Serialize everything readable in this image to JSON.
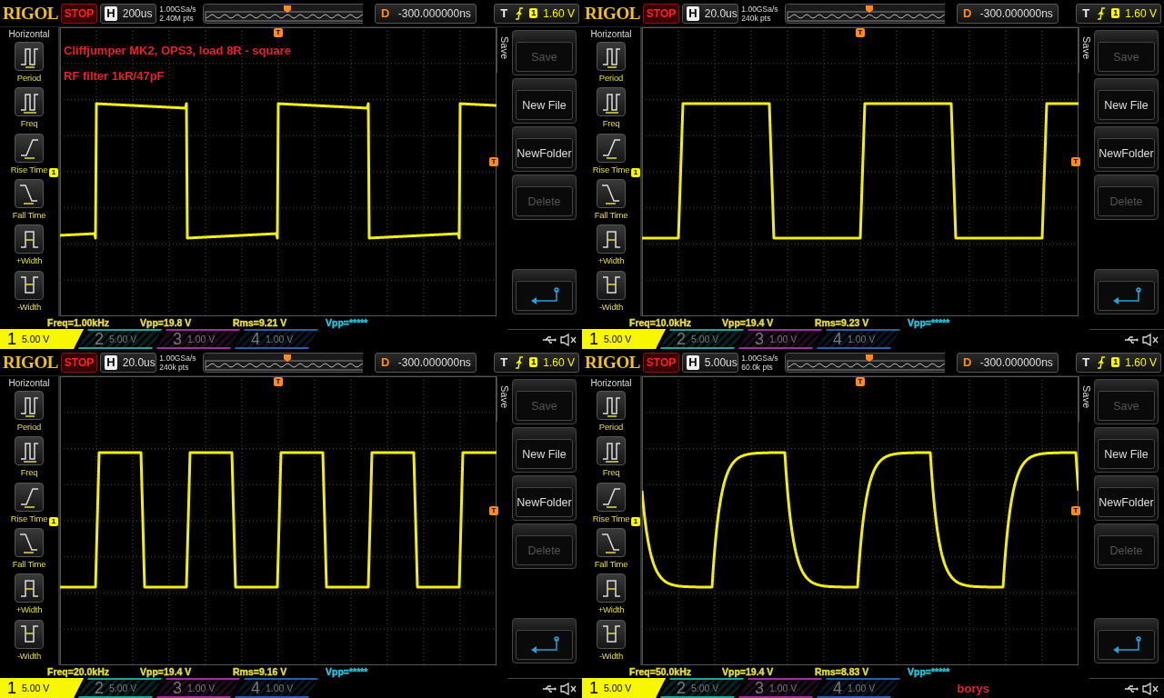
{
  "panels": [
    {
      "brand": "RIGOL",
      "run_state": "STOP",
      "timebase_label": "H",
      "timebase": "200us",
      "sample_rate": "1.00GSa/s",
      "memory_depth": "2.40M pts",
      "delay_label": "D",
      "delay": "-300.000000ns",
      "trigger_label": "T",
      "trigger_source": "1",
      "trigger_level": "1.60 V",
      "sidebar_title": "Horizontal",
      "sidebar_items": [
        {
          "label": "Period",
          "kind": "period"
        },
        {
          "label": "Freq",
          "kind": "freq"
        },
        {
          "label": "Rise Time",
          "kind": "rise"
        },
        {
          "label": "Fall Time",
          "kind": "fall"
        },
        {
          "label": "+Width",
          "kind": "pwidth"
        },
        {
          "label": "-Width",
          "kind": "nwidth"
        }
      ],
      "notes": [
        "Cliffjumper MK2, OPS3, load 8R - square",
        "RF filter 1kR/47pF"
      ],
      "channel_marker": "1",
      "trigger_marker_top": "T",
      "trigger_marker_right": "T",
      "menu_title": "Save",
      "menu_buttons": [
        {
          "kind": "text",
          "label": "Save",
          "disabled": true
        },
        {
          "kind": "text",
          "label": "New File",
          "disabled": false
        },
        {
          "kind": "text",
          "label": "NewFolder",
          "disabled": false
        },
        {
          "kind": "text",
          "label": "Delete",
          "disabled": true
        },
        {
          "kind": "enter"
        }
      ],
      "measurements": [
        {
          "text": "Freq=1.00kHz",
          "kind": "ch1"
        },
        {
          "text": "Vpp=19.8 V",
          "kind": "ch1"
        },
        {
          "text": "Rms=9.21 V",
          "kind": "ch1"
        },
        {
          "text": "Vpp=*****",
          "kind": "ch2"
        }
      ],
      "channels": [
        {
          "number": "1",
          "scale": "5.00 V",
          "selected": true,
          "color": "#f7f700"
        },
        {
          "number": "2",
          "scale": "5.00 V",
          "selected": false,
          "color": "#1fa39a"
        },
        {
          "number": "3",
          "scale": "1.00 V",
          "selected": false,
          "color": "#a0309a"
        },
        {
          "number": "4",
          "scale": "1.00 V",
          "selected": false,
          "color": "#2a5fa8"
        }
      ]
    },
    {
      "brand": "RIGOL",
      "run_state": "STOP",
      "timebase_label": "H",
      "timebase": "20.0us",
      "sample_rate": "1.00GSa/s",
      "memory_depth": "240k pts",
      "delay_label": "D",
      "delay": "-300.000000ns",
      "trigger_label": "T",
      "trigger_source": "1",
      "trigger_level": "1.60 V",
      "sidebar_title": "Horizontal",
      "sidebar_items": [
        {
          "label": "Period",
          "kind": "period"
        },
        {
          "label": "Freq",
          "kind": "freq"
        },
        {
          "label": "Rise Time",
          "kind": "rise"
        },
        {
          "label": "Fall Time",
          "kind": "fall"
        },
        {
          "label": "+Width",
          "kind": "pwidth"
        },
        {
          "label": "-Width",
          "kind": "nwidth"
        }
      ],
      "channel_marker": "1",
      "trigger_marker_top": "T",
      "trigger_marker_right": "T",
      "menu_title": "Save",
      "menu_buttons": [
        {
          "kind": "text",
          "label": "Save",
          "disabled": true
        },
        {
          "kind": "text",
          "label": "New File",
          "disabled": false
        },
        {
          "kind": "text",
          "label": "NewFolder",
          "disabled": false
        },
        {
          "kind": "text",
          "label": "Delete",
          "disabled": true
        },
        {
          "kind": "enter"
        }
      ],
      "measurements": [
        {
          "text": "Freq=10.0kHz",
          "kind": "ch1"
        },
        {
          "text": "Vpp=19.4 V",
          "kind": "ch1"
        },
        {
          "text": "Rms=9.23 V",
          "kind": "ch1"
        },
        {
          "text": "Vpp=*****",
          "kind": "ch2"
        }
      ],
      "channels": [
        {
          "number": "1",
          "scale": "5.00 V",
          "selected": true,
          "color": "#f7f700"
        },
        {
          "number": "2",
          "scale": "5.00 V",
          "selected": false,
          "color": "#1fa39a"
        },
        {
          "number": "3",
          "scale": "1.00 V",
          "selected": false,
          "color": "#a0309a"
        },
        {
          "number": "4",
          "scale": "1.00 V",
          "selected": false,
          "color": "#2a5fa8"
        }
      ]
    },
    {
      "brand": "RIGOL",
      "run_state": "STOP",
      "timebase_label": "H",
      "timebase": "20.0us",
      "sample_rate": "1.00GSa/s",
      "memory_depth": "240k pts",
      "delay_label": "D",
      "delay": "-300.000000ns",
      "trigger_label": "T",
      "trigger_source": "1",
      "trigger_level": "1.60 V",
      "sidebar_title": "Horizontal",
      "sidebar_items": [
        {
          "label": "Period",
          "kind": "period"
        },
        {
          "label": "Freq",
          "kind": "freq"
        },
        {
          "label": "Rise Time",
          "kind": "rise"
        },
        {
          "label": "Fall Time",
          "kind": "fall"
        },
        {
          "label": "+Width",
          "kind": "pwidth"
        },
        {
          "label": "-Width",
          "kind": "nwidth"
        }
      ],
      "channel_marker": "1",
      "trigger_marker_top": "T",
      "trigger_marker_right": "T",
      "menu_title": "Save",
      "menu_buttons": [
        {
          "kind": "text",
          "label": "Save",
          "disabled": true
        },
        {
          "kind": "text",
          "label": "New File",
          "disabled": false
        },
        {
          "kind": "text",
          "label": "NewFolder",
          "disabled": false
        },
        {
          "kind": "text",
          "label": "Delete",
          "disabled": true
        },
        {
          "kind": "enter"
        }
      ],
      "measurements": [
        {
          "text": "Freq=20.0kHz",
          "kind": "ch1"
        },
        {
          "text": "Vpp=19.4 V",
          "kind": "ch1"
        },
        {
          "text": "Rms=9.16 V",
          "kind": "ch1"
        },
        {
          "text": "Vpp=*****",
          "kind": "ch2"
        }
      ],
      "channels": [
        {
          "number": "1",
          "scale": "5.00 V",
          "selected": true,
          "color": "#f7f700"
        },
        {
          "number": "2",
          "scale": "5.00 V",
          "selected": false,
          "color": "#1fa39a"
        },
        {
          "number": "3",
          "scale": "1.00 V",
          "selected": false,
          "color": "#a0309a"
        },
        {
          "number": "4",
          "scale": "1.00 V",
          "selected": false,
          "color": "#2a5fa8"
        }
      ]
    },
    {
      "brand": "RIGOL",
      "run_state": "STOP",
      "timebase_label": "H",
      "timebase": "5.00us",
      "sample_rate": "1.00GSa/s",
      "memory_depth": "60.0k pts",
      "delay_label": "D",
      "delay": "-300.000000ns",
      "trigger_label": "T",
      "trigger_source": "1",
      "trigger_level": "1.60 V",
      "sidebar_title": "Horizontal",
      "sidebar_items": [
        {
          "label": "Period",
          "kind": "period"
        },
        {
          "label": "Freq",
          "kind": "freq"
        },
        {
          "label": "Rise Time",
          "kind": "rise"
        },
        {
          "label": "Fall Time",
          "kind": "fall"
        },
        {
          "label": "+Width",
          "kind": "pwidth"
        },
        {
          "label": "-Width",
          "kind": "nwidth"
        }
      ],
      "channel_marker": "1",
      "trigger_marker_top": "T",
      "trigger_marker_right": "T",
      "menu_title": "Save",
      "menu_buttons": [
        {
          "kind": "text",
          "label": "Save",
          "disabled": true
        },
        {
          "kind": "text",
          "label": "New File",
          "disabled": false
        },
        {
          "kind": "text",
          "label": "NewFolder",
          "disabled": false
        },
        {
          "kind": "text",
          "label": "Delete",
          "disabled": true
        },
        {
          "kind": "enter"
        }
      ],
      "measurements": [
        {
          "text": "Freq=50.0kHz",
          "kind": "ch1"
        },
        {
          "text": "Vpp=19.4 V",
          "kind": "ch1"
        },
        {
          "text": "Rms=8.83 V",
          "kind": "ch1"
        },
        {
          "text": "Vpp=*****",
          "kind": "ch2"
        }
      ],
      "channels": [
        {
          "number": "1",
          "scale": "5.00 V",
          "selected": true,
          "color": "#f7f700"
        },
        {
          "number": "2",
          "scale": "5.00 V",
          "selected": false,
          "color": "#1fa39a"
        },
        {
          "number": "3",
          "scale": "1.00 V",
          "selected": false,
          "color": "#a0309a"
        },
        {
          "number": "4",
          "scale": "1.00 V",
          "selected": false,
          "color": "#2a5fa8"
        }
      ],
      "signature": "borys"
    }
  ]
}
